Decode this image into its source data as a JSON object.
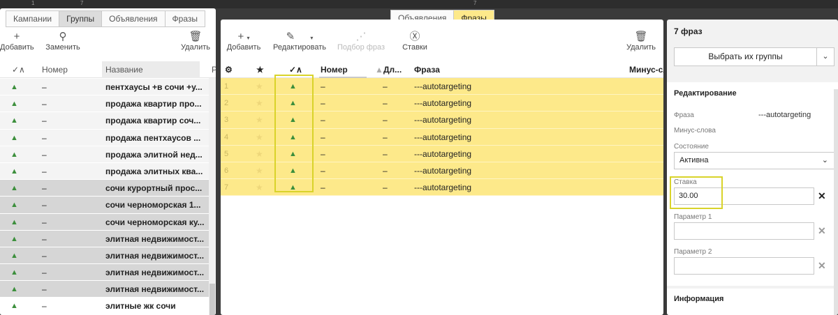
{
  "topstrip": {
    "num_left": "1",
    "num_left2": "7",
    "num_mid": "7"
  },
  "left": {
    "tabs": [
      {
        "label": "Кампании",
        "active": false
      },
      {
        "label": "Группы",
        "active": true
      },
      {
        "label": "Объявления",
        "active": false
      },
      {
        "label": "Фразы",
        "active": false
      }
    ],
    "toolbar": {
      "add": "Добавить",
      "replace": "Заменить",
      "delete": "Удалить"
    },
    "columns": {
      "icon": "✓∧",
      "number": "Номер",
      "name": "Название",
      "extra": "Р"
    },
    "rows": [
      {
        "num": "–",
        "name": "пентхаусы +в сочи +у...",
        "sel": false
      },
      {
        "num": "–",
        "name": "продажа квартир про...",
        "sel": false
      },
      {
        "num": "–",
        "name": "продажа квартир соч...",
        "sel": false
      },
      {
        "num": "–",
        "name": "продажа пентхаусов ...",
        "sel": false
      },
      {
        "num": "–",
        "name": "продажа элитной нед...",
        "sel": false
      },
      {
        "num": "–",
        "name": "продажа элитных ква...",
        "sel": false
      },
      {
        "num": "–",
        "name": "сочи курортный прос...",
        "sel": true
      },
      {
        "num": "–",
        "name": "сочи черноморская 1...",
        "sel": true
      },
      {
        "num": "–",
        "name": "сочи черноморская ку...",
        "sel": true
      },
      {
        "num": "–",
        "name": "элитная недвижимост...",
        "sel": true
      },
      {
        "num": "–",
        "name": "элитная недвижимост...",
        "sel": true
      },
      {
        "num": "–",
        "name": "элитная недвижимост...",
        "sel": true
      },
      {
        "num": "–",
        "name": "элитная недвижимост...",
        "sel": true
      },
      {
        "num": "–",
        "name": "элитные жк сочи",
        "sel": false
      }
    ]
  },
  "mid": {
    "tabs": [
      {
        "label": "Объявления",
        "active": false
      },
      {
        "label": "Фразы",
        "active": true
      }
    ],
    "toolbar": {
      "add": "Добавить",
      "edit": "Редактировать",
      "pick": "Подбор фраз",
      "bids": "Ставки",
      "delete": "Удалить"
    },
    "columns": {
      "gear": "⚙",
      "star": "★",
      "status": "✓∧",
      "number": "Номер",
      "len": "Дл...",
      "phrase": "Фраза",
      "minus": "Минус-сл"
    },
    "rows": [
      {
        "n": "1",
        "num": "–",
        "len": "–",
        "phrase": "---autotargeting"
      },
      {
        "n": "2",
        "num": "–",
        "len": "–",
        "phrase": "---autotargeting"
      },
      {
        "n": "3",
        "num": "–",
        "len": "–",
        "phrase": "---autotargeting"
      },
      {
        "n": "4",
        "num": "–",
        "len": "–",
        "phrase": "---autotargeting"
      },
      {
        "n": "5",
        "num": "–",
        "len": "–",
        "phrase": "---autotargeting"
      },
      {
        "n": "6",
        "num": "–",
        "len": "–",
        "phrase": "---autotargeting"
      },
      {
        "n": "7",
        "num": "–",
        "len": "–",
        "phrase": "---autotargeting"
      }
    ]
  },
  "right": {
    "title": "7 фраз",
    "select_groups": "Выбрать их группы",
    "editing_head": "Редактирование",
    "phrase_label": "Фраза",
    "phrase_value": "---autotargeting",
    "minus_label": "Минус-слова",
    "state_label": "Состояние",
    "state_value": "Активна",
    "bid_label": "Ставка",
    "bid_value": "30.00",
    "param1_label": "Параметр 1",
    "param1_value": "",
    "param2_label": "Параметр 2",
    "param2_value": "",
    "info_head": "Информация"
  },
  "colors": {
    "highlight": "#fde98a",
    "accent_box": "#d9d32a",
    "status_icon": "#3c8f3c"
  }
}
